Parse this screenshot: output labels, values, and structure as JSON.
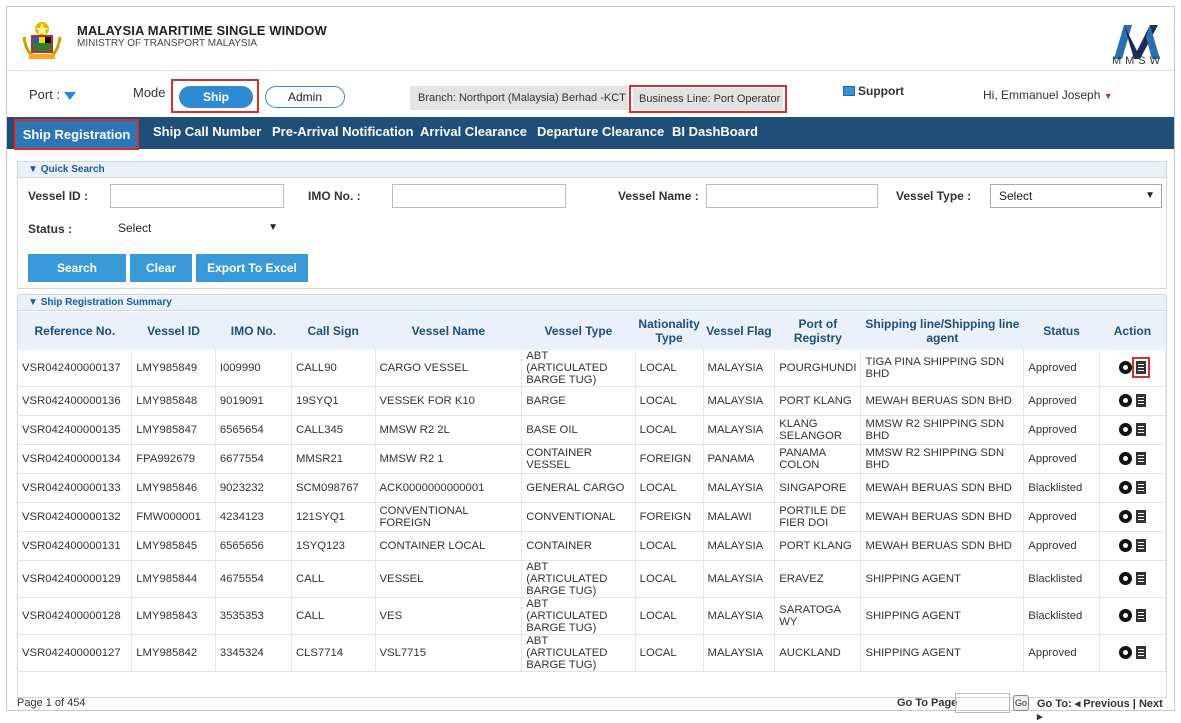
{
  "header": {
    "brand_title": "MALAYSIA MARITIME SINGLE WINDOW",
    "brand_subtitle": "MINISTRY OF TRANSPORT MALAYSIA",
    "logo_text": "MMSW"
  },
  "topbar": {
    "port_label": "Port :",
    "mode_label": "Mode",
    "mode_ship": "Ship",
    "mode_admin": "Admin",
    "branch": "Branch: Northport (Malaysia) Berhad -KCT",
    "business_line": "Business Line: Port Operator",
    "support": "Support",
    "user": "Hi, Emmanuel Joseph"
  },
  "nav": {
    "items": [
      "Ship Registration",
      "Ship Call Number",
      "Pre-Arrival Notification",
      "Arrival Clearance",
      "Departure Clearance",
      "BI DashBoard"
    ]
  },
  "quick_search": {
    "title": "Quick Search",
    "vessel_id_label": "Vessel ID :",
    "imo_label": "IMO No. :",
    "vessel_name_label": "Vessel Name :",
    "vessel_type_label": "Vessel Type :",
    "vessel_type_value": "Select",
    "status_label": "Status :",
    "status_value": "Select",
    "search_btn": "Search",
    "clear_btn": "Clear",
    "export_btn": "Export To Excel"
  },
  "summary": {
    "title": "Ship Registration Summary",
    "columns": [
      "Reference No.",
      "Vessel ID",
      "IMO No.",
      "Call Sign",
      "Vessel Name",
      "Vessel Type",
      "Nationality Type",
      "Vessel Flag",
      "Port of Registry",
      "Shipping line/Shipping line agent",
      "Status",
      "Action"
    ],
    "rows": [
      [
        "VSR042400000137",
        "LMY985849",
        "I009990",
        "CALL90",
        "CARGO VESSEL",
        "ABT (ARTICULATED BARGE TUG)",
        "LOCAL",
        "MALAYSIA",
        "POURGHUNDI",
        "TIGA PINA SHIPPING SDN BHD",
        "Approved"
      ],
      [
        "VSR042400000136",
        "LMY985848",
        "9019091",
        "19SYQ1",
        "VESSEK FOR K10",
        "BARGE",
        "LOCAL",
        "MALAYSIA",
        "PORT KLANG",
        "MEWAH BERUAS SDN BHD",
        "Approved"
      ],
      [
        "VSR042400000135",
        "LMY985847",
        "6565654",
        "CALL345",
        "MMSW R2 2L",
        "BASE OIL",
        "LOCAL",
        "MALAYSIA",
        "KLANG SELANGOR",
        "MMSW R2 SHIPPING SDN BHD",
        "Approved"
      ],
      [
        "VSR042400000134",
        "FPA992679",
        "6677554",
        "MMSR21",
        "MMSW R2 1",
        "CONTAINER VESSEL",
        "FOREIGN",
        "PANAMA",
        "PANAMA COLON",
        "MMSW R2 SHIPPING SDN BHD",
        "Approved"
      ],
      [
        "VSR042400000133",
        "LMY985846",
        "9023232",
        "SCM098767",
        "ACK0000000000001",
        "GENERAL CARGO",
        "LOCAL",
        "MALAYSIA",
        "SINGAPORE",
        "MEWAH BERUAS SDN BHD",
        "Blacklisted"
      ],
      [
        "VSR042400000132",
        "FMW000001",
        "4234123",
        "121SYQ1",
        "CONVENTIONAL FOREIGN",
        "CONVENTIONAL",
        "FOREIGN",
        "MALAWI",
        "PORTILE DE FIER DOI",
        "MEWAH BERUAS SDN BHD",
        "Approved"
      ],
      [
        "VSR042400000131",
        "LMY985845",
        "6565656",
        "1SYQ123",
        "CONTAINER LOCAL",
        "CONTAINER",
        "LOCAL",
        "MALAYSIA",
        "PORT KLANG",
        "MEWAH BERUAS SDN BHD",
        "Approved"
      ],
      [
        "VSR042400000129",
        "LMY985844",
        "4675554",
        "CALL",
        "VESSEL",
        "ABT (ARTICULATED BARGE TUG)",
        "LOCAL",
        "MALAYSIA",
        "ERAVEZ",
        "SHIPPING AGENT",
        "Blacklisted"
      ],
      [
        "VSR042400000128",
        "LMY985843",
        "3535353",
        "CALL",
        "VES",
        "ABT (ARTICULATED BARGE TUG)",
        "LOCAL",
        "MALAYSIA",
        "SARATOGA WY",
        "SHIPPING AGENT",
        "Blacklisted"
      ],
      [
        "VSR042400000127",
        "LMY985842",
        "3345324",
        "CLS7714",
        "VSL7715",
        "ABT (ARTICULATED BARGE TUG)",
        "LOCAL",
        "MALAYSIA",
        "AUCKLAND",
        "SHIPPING AGENT",
        "Approved"
      ]
    ]
  },
  "footer": {
    "page_info": "Page 1 of 454",
    "go_to_page": "Go To Page",
    "go_btn": "Go",
    "go_to": "Go To:",
    "previous": "Previous",
    "next": "Next"
  }
}
